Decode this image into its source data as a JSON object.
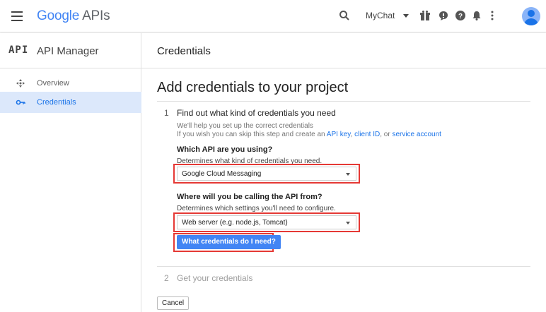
{
  "topbar": {
    "brand_google": "Google",
    "brand_apis": "APIs",
    "project_name": "MyChat",
    "icons": [
      "menu-icon",
      "search-icon",
      "chevron-down-icon",
      "gift-icon",
      "feedback-icon",
      "help-icon",
      "notifications-icon",
      "more-vert-icon",
      "avatar-icon"
    ]
  },
  "subbar": {
    "badge": "API",
    "product_title": "API Manager",
    "page_header": "Credentials"
  },
  "sidebar": {
    "items": [
      {
        "label": "Overview",
        "icon": "overview-icon",
        "active": false
      },
      {
        "label": "Credentials",
        "icon": "key-icon",
        "active": true
      }
    ]
  },
  "main": {
    "title": "Add credentials to your project",
    "step1": {
      "number": "1",
      "title": "Find out what kind of credentials you need",
      "help_line1": "We'll help you set up the correct credentials",
      "help_line2_prefix": "If you wish you can skip this step and create an ",
      "link_api_key": "API key",
      "sep1": ", ",
      "link_client_id": "client ID",
      "sep2": ", or ",
      "link_service_account": "service account",
      "q1_label": "Which API are you using?",
      "q1_hint": "Determines what kind of credentials you need.",
      "q1_value": "Google Cloud Messaging",
      "q2_label": "Where will you be calling the API from?",
      "q2_hint": "Determines which settings you'll need to configure.",
      "q2_value": "Web server (e.g. node.js, Tomcat)",
      "button": "What credentials do I need?"
    },
    "step2": {
      "number": "2",
      "title": "Get your credentials"
    },
    "cancel": "Cancel"
  },
  "colors": {
    "accent": "#4285f4",
    "highlight": "#e53935",
    "active_nav_bg": "#dce8fb"
  }
}
